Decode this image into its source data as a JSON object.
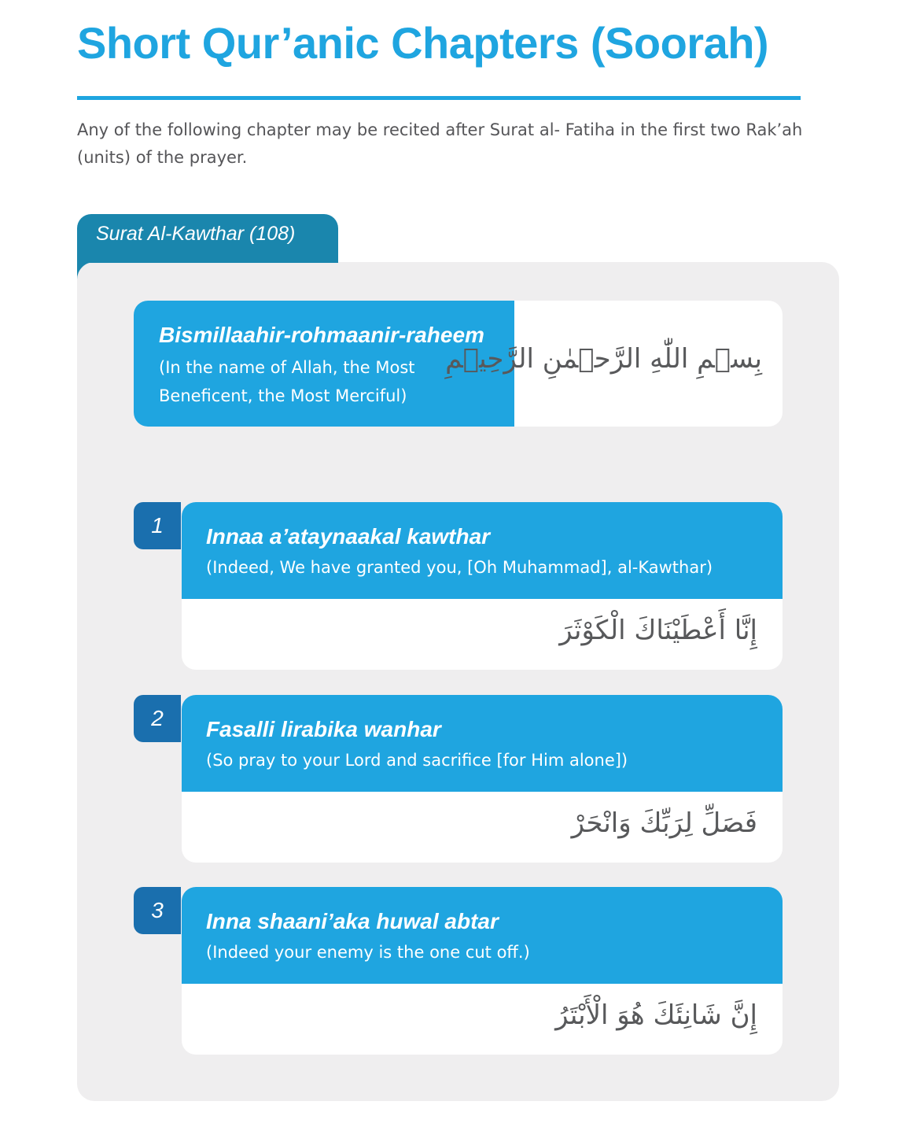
{
  "page": {
    "title": "Short Qur’anic Chapters (Soorah)",
    "intro": "Any of the following chapter may be recited after Surat al- Fatiha in the first two Rak’ah (units) of the prayer."
  },
  "surah": {
    "tab_label": "Surat Al-Kawthar (108)",
    "bismillah": {
      "transliteration": "Bismillaahir-rohmaanir-raheem",
      "translation": "(In the name of Allah, the Most Beneficent, the Most Merciful)",
      "arabic": "بِسۡمِ اللّٰهِ الرَّحۡمٰنِ الرَّحِيۡمِ"
    },
    "verses": [
      {
        "number": "1",
        "transliteration": "Innaa a’ataynaakal kawthar",
        "translation": "(Indeed, We have granted you, [Oh Muhammad], al-Kawthar)",
        "arabic": "إِنَّا أَعْطَيْنَاكَ الْكَوْثَرَ"
      },
      {
        "number": "2",
        "transliteration": "Fasalli lirabika wanhar",
        "translation": "(So pray to your Lord and sacrifice [for Him alone])",
        "arabic": "فَصَلِّ لِرَبِّكَ وَانْحَرْ"
      },
      {
        "number": "3",
        "transliteration": "Inna shaani’aka huwal abtar",
        "translation": "(Indeed your enemy is the one cut off.)",
        "arabic": "إِنَّ شَانِئَكَ هُوَ الْأَبْتَرُ"
      }
    ]
  },
  "colors": {
    "accent": "#1fa5e0",
    "tab": "#1a86ad",
    "number_badge": "#1a6fae",
    "panel": "#efeeef",
    "body_text": "#555558"
  }
}
